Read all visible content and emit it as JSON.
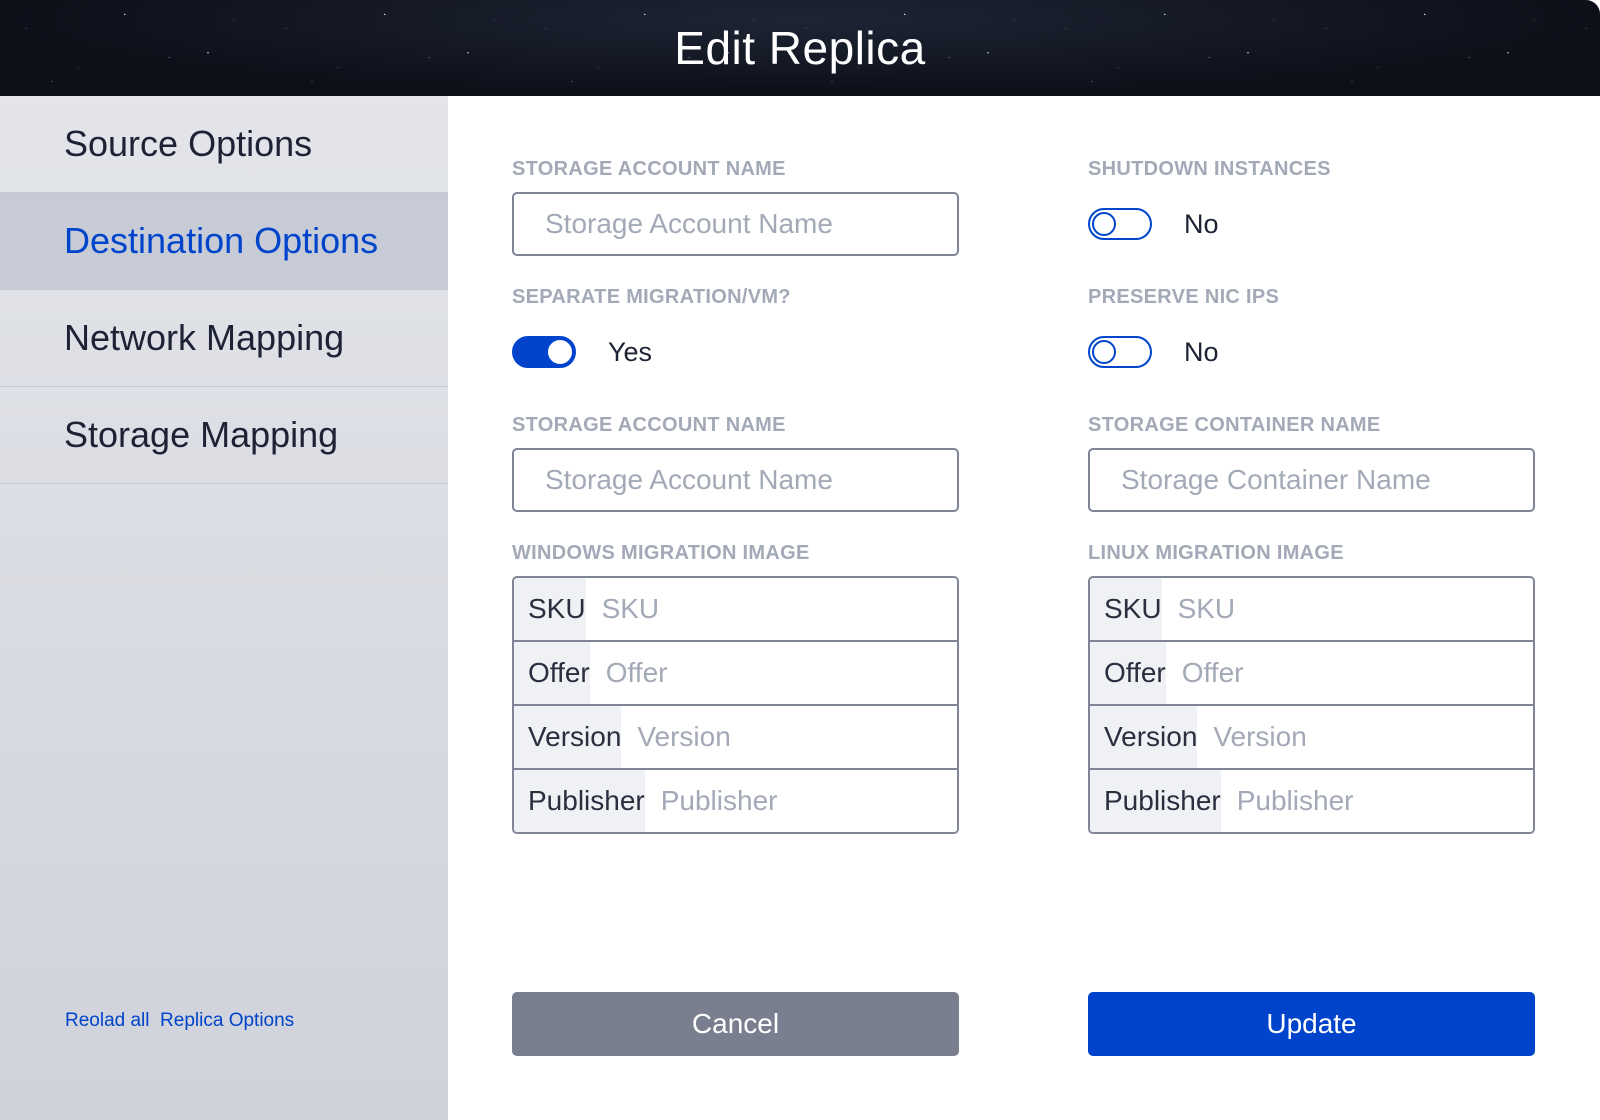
{
  "title": "Edit Replica",
  "sidebar": {
    "items": [
      {
        "label": "Source Options"
      },
      {
        "label": "Destination Options"
      },
      {
        "label": "Network Mapping"
      },
      {
        "label": "Storage Mapping"
      }
    ],
    "reload_label": "Reolad all  Replica Options"
  },
  "fields": {
    "storage_account_1": {
      "label": "STORAGE ACCOUNT NAME",
      "placeholder": "Storage Account Name"
    },
    "shutdown": {
      "label": "SHUTDOWN INSTANCES",
      "value": "No"
    },
    "separate": {
      "label": "SEPARATE MIGRATION/VM?",
      "value": "Yes"
    },
    "preserve": {
      "label": "PRESERVE NIC IPS",
      "value": "No"
    },
    "storage_account_2": {
      "label": "STORAGE ACCOUNT NAME",
      "placeholder": "Storage Account Name"
    },
    "storage_container": {
      "label": "STORAGE CONTAINER NAME",
      "placeholder": "Storage Container Name"
    },
    "windows": {
      "label": "WINDOWS MIGRATION IMAGE",
      "rows": [
        {
          "key": "SKU",
          "placeholder": "SKU"
        },
        {
          "key": "Offer",
          "placeholder": "Offer"
        },
        {
          "key": "Version",
          "placeholder": "Version"
        },
        {
          "key": "Publisher",
          "placeholder": "Publisher"
        }
      ]
    },
    "linux": {
      "label": "LINUX MIGRATION IMAGE",
      "rows": [
        {
          "key": "SKU",
          "placeholder": "SKU"
        },
        {
          "key": "Offer",
          "placeholder": "Offer"
        },
        {
          "key": "Version",
          "placeholder": "Version"
        },
        {
          "key": "Publisher",
          "placeholder": "Publisher"
        }
      ]
    }
  },
  "buttons": {
    "cancel": "Cancel",
    "update": "Update"
  },
  "colors": {
    "accent": "#0044cc",
    "cancel": "#7a7f8f"
  }
}
